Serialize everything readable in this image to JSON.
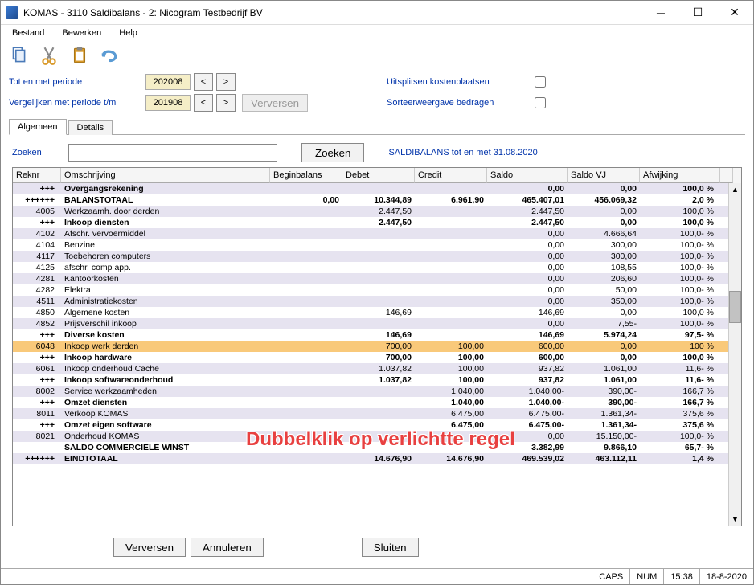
{
  "window": {
    "title": "KOMAS - 3110 Saldibalans - 2: Nicogram Testbedrijf BV"
  },
  "menu": {
    "bestand": "Bestand",
    "bewerken": "Bewerken",
    "help": "Help"
  },
  "params": {
    "tot_label": "Tot en met periode",
    "tot_value": "202008",
    "vergelijken_label": "Vergelijken met periode t/m",
    "vergelijken_value": "201908",
    "verversen_label": "Verversen",
    "uitsplitsen_label": "Uitsplitsen kostenplaatsen",
    "sorteer_label": "Sorteerweergave bedragen"
  },
  "tabs": {
    "algemeen": "Algemeen",
    "details": "Details"
  },
  "search": {
    "zoeken_label": "Zoeken",
    "value": "",
    "button": "Zoeken",
    "subtitle": "SALDIBALANS tot en met 31.08.2020"
  },
  "columns": {
    "reknr": "Reknr",
    "omschrijving": "Omschrijving",
    "beginbalans": "Beginbalans",
    "debet": "Debet",
    "credit": "Credit",
    "saldo": "Saldo",
    "saldovj": "Saldo VJ",
    "afwijking": "Afwijking"
  },
  "rows": [
    {
      "reknr": "+++",
      "om": "Overgangsrekening",
      "beg": "",
      "deb": "",
      "cre": "",
      "sal": "0,00",
      "svj": "0,00",
      "afw": "100,0  %",
      "bold": true
    },
    {
      "reknr": "++++++",
      "om": "BALANSTOTAAL",
      "beg": "0,00",
      "deb": "10.344,89",
      "cre": "6.961,90",
      "sal": "465.407,01",
      "svj": "456.069,32",
      "afw": "2,0  %",
      "bold": true
    },
    {
      "reknr": "4005",
      "om": "Werkzaamh. door derden",
      "beg": "",
      "deb": "2.447,50",
      "cre": "",
      "sal": "2.447,50",
      "svj": "0,00",
      "afw": "100,0  %"
    },
    {
      "reknr": "+++",
      "om": "Inkoop diensten",
      "beg": "",
      "deb": "2.447,50",
      "cre": "",
      "sal": "2.447,50",
      "svj": "0,00",
      "afw": "100,0  %",
      "bold": true
    },
    {
      "reknr": "4102",
      "om": "Afschr. vervoermiddel",
      "beg": "",
      "deb": "",
      "cre": "",
      "sal": "0,00",
      "svj": "4.666,64",
      "afw": "100,0- %"
    },
    {
      "reknr": "4104",
      "om": "Benzine",
      "beg": "",
      "deb": "",
      "cre": "",
      "sal": "0,00",
      "svj": "300,00",
      "afw": "100,0- %"
    },
    {
      "reknr": "4117",
      "om": "Toebehoren computers",
      "beg": "",
      "deb": "",
      "cre": "",
      "sal": "0,00",
      "svj": "300,00",
      "afw": "100,0- %"
    },
    {
      "reknr": "4125",
      "om": "afschr. comp app.",
      "beg": "",
      "deb": "",
      "cre": "",
      "sal": "0,00",
      "svj": "108,55",
      "afw": "100,0- %"
    },
    {
      "reknr": "4281",
      "om": "Kantoorkosten",
      "beg": "",
      "deb": "",
      "cre": "",
      "sal": "0,00",
      "svj": "206,60",
      "afw": "100,0- %"
    },
    {
      "reknr": "4282",
      "om": "Elektra",
      "beg": "",
      "deb": "",
      "cre": "",
      "sal": "0,00",
      "svj": "50,00",
      "afw": "100,0- %"
    },
    {
      "reknr": "4511",
      "om": "Administratiekosten",
      "beg": "",
      "deb": "",
      "cre": "",
      "sal": "0,00",
      "svj": "350,00",
      "afw": "100,0- %"
    },
    {
      "reknr": "4850",
      "om": "Algemene kosten",
      "beg": "",
      "deb": "146,69",
      "cre": "",
      "sal": "146,69",
      "svj": "0,00",
      "afw": "100,0  %"
    },
    {
      "reknr": "4852",
      "om": "Prijsverschil inkoop",
      "beg": "",
      "deb": "",
      "cre": "",
      "sal": "0,00",
      "svj": "7,55-",
      "afw": "100,0- %"
    },
    {
      "reknr": "+++",
      "om": "Diverse kosten",
      "beg": "",
      "deb": "146,69",
      "cre": "",
      "sal": "146,69",
      "svj": "5.974,24",
      "afw": "97,5- %",
      "bold": true
    },
    {
      "reknr": "6048",
      "om": "Inkoop werk derden",
      "beg": "",
      "deb": "700,00",
      "cre": "100,00",
      "sal": "600,00",
      "svj": "0,00",
      "afw": "100  %",
      "highlight": true
    },
    {
      "reknr": "+++",
      "om": "Inkoop hardware",
      "beg": "",
      "deb": "700,00",
      "cre": "100,00",
      "sal": "600,00",
      "svj": "0,00",
      "afw": "100,0  %",
      "bold": true
    },
    {
      "reknr": "6061",
      "om": "Inkoop onderhoud Cache",
      "beg": "",
      "deb": "1.037,82",
      "cre": "100,00",
      "sal": "937,82",
      "svj": "1.061,00",
      "afw": "11,6- %"
    },
    {
      "reknr": "+++",
      "om": "Inkoop softwareonderhoud",
      "beg": "",
      "deb": "1.037,82",
      "cre": "100,00",
      "sal": "937,82",
      "svj": "1.061,00",
      "afw": "11,6- %",
      "bold": true
    },
    {
      "reknr": "8002",
      "om": "Service werkzaamheden",
      "beg": "",
      "deb": "",
      "cre": "1.040,00",
      "sal": "1.040,00-",
      "svj": "390,00-",
      "afw": "166,7  %"
    },
    {
      "reknr": "+++",
      "om": "Omzet diensten",
      "beg": "",
      "deb": "",
      "cre": "1.040,00",
      "sal": "1.040,00-",
      "svj": "390,00-",
      "afw": "166,7  %",
      "bold": true
    },
    {
      "reknr": "8011",
      "om": "Verkoop KOMAS",
      "beg": "",
      "deb": "",
      "cre": "6.475,00",
      "sal": "6.475,00-",
      "svj": "1.361,34-",
      "afw": "375,6  %"
    },
    {
      "reknr": "+++",
      "om": "Omzet eigen software",
      "beg": "",
      "deb": "",
      "cre": "6.475,00",
      "sal": "6.475,00-",
      "svj": "1.361,34-",
      "afw": "375,6  %",
      "bold": true
    },
    {
      "reknr": "8021",
      "om": "Onderhoud KOMAS",
      "beg": "",
      "deb": "",
      "cre": "",
      "sal": "0,00",
      "svj": "15.150,00-",
      "afw": "100,0- %"
    },
    {
      "reknr": "",
      "om": "SALDO COMMERCIELE WINST",
      "beg": "",
      "deb": "",
      "cre": "",
      "sal": "3.382,99",
      "svj": "9.866,10",
      "afw": "65,7- %",
      "bold": true
    },
    {
      "reknr": "++++++",
      "om": "EINDTOTAAL",
      "beg": "",
      "deb": "14.676,90",
      "cre": "14.676,90",
      "sal": "469.539,02",
      "svj": "463.112,11",
      "afw": "1,4  %",
      "bold": true
    }
  ],
  "overlay": "Dubbelklik op verlichtte regel",
  "footer": {
    "verversen": "Verversen",
    "annuleren": "Annuleren",
    "sluiten": "Sluiten"
  },
  "status": {
    "caps": "CAPS",
    "num": "NUM",
    "time": "15:38",
    "date": "18-8-2020"
  }
}
